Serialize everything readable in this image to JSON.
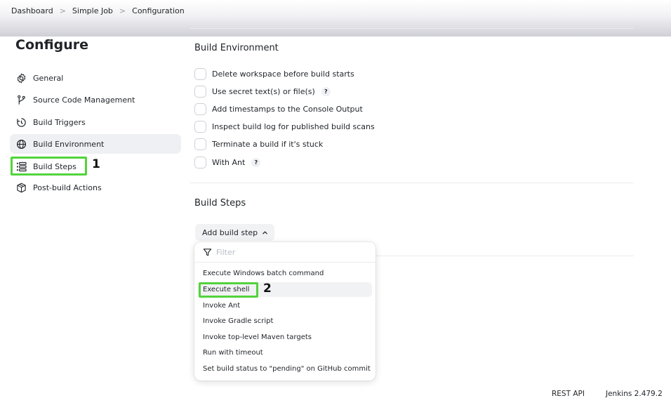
{
  "breadcrumb": {
    "items": [
      "Dashboard",
      "Simple Job",
      "Configuration"
    ],
    "separator": ">"
  },
  "sidebar": {
    "title": "Configure",
    "items": [
      {
        "label": "General",
        "icon": "gear-icon"
      },
      {
        "label": "Source Code Management",
        "icon": "git-branch-icon"
      },
      {
        "label": "Build Triggers",
        "icon": "clock-icon"
      },
      {
        "label": "Build Environment",
        "icon": "globe-icon"
      },
      {
        "label": "Build Steps",
        "icon": "list-icon"
      },
      {
        "label": "Post-build Actions",
        "icon": "package-icon"
      }
    ],
    "active_item": "Build Environment"
  },
  "annotations": {
    "step1": "1",
    "step2": "2",
    "highlight_color": "#52d33c"
  },
  "build_environment": {
    "title": "Build Environment",
    "options": [
      {
        "label": "Delete workspace before build starts",
        "help": false
      },
      {
        "label": "Use secret text(s) or file(s)",
        "help": true
      },
      {
        "label": "Add timestamps to the Console Output",
        "help": false
      },
      {
        "label": "Inspect build log for published build scans",
        "help": false
      },
      {
        "label": "Terminate a build if it's stuck",
        "help": false
      },
      {
        "label": "With Ant",
        "help": true
      }
    ],
    "help_glyph": "?"
  },
  "build_steps": {
    "title": "Build Steps",
    "add_button": "Add build step",
    "filter_placeholder": "Filter",
    "menu_items": [
      "Execute Windows batch command",
      "Execute shell",
      "Invoke Ant",
      "Invoke Gradle script",
      "Invoke top-level Maven targets",
      "Run with timeout",
      "Set build status to \"pending\" on GitHub commit"
    ],
    "hovered_item": "Execute shell"
  },
  "footer": {
    "rest_api": "REST API",
    "version": "Jenkins 2.479.2"
  }
}
